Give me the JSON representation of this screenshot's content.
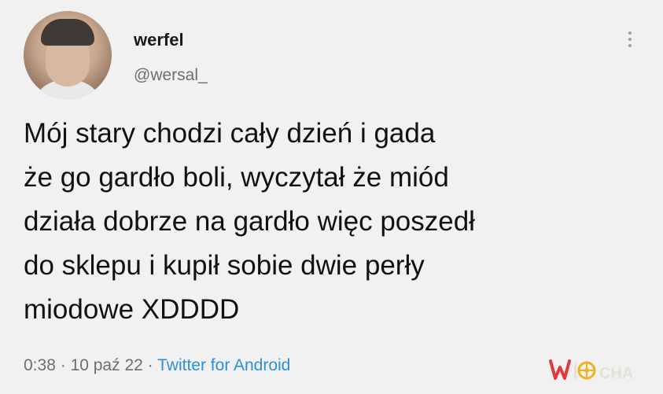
{
  "tweet": {
    "display_name": "werfel",
    "handle": "@wersal_",
    "text_lines": [
      "Mój stary chodzi cały dzień i gada",
      "że go gardło boli, wyczytał że miód",
      "działa dobrze na gardło więc poszedł",
      "do sklepu i kupił sobie dwie perły",
      "miodowe XDDDD"
    ],
    "time": "0:38",
    "separator": "·",
    "date": "10 paź 22",
    "source": "Twitter for Android"
  },
  "watermark": {
    "text": "WIOCHA",
    "colors": {
      "w": "#e13a3a",
      "flower": "#f2b01e",
      "rest": "#e5e0d8"
    }
  },
  "icons": {
    "more": "more-vertical-icon",
    "avatar": "avatar-photo"
  },
  "colors": {
    "background": "#f1f1f1",
    "text": "#111111",
    "secondary": "#6b6f73",
    "link": "#2d8fd5"
  }
}
